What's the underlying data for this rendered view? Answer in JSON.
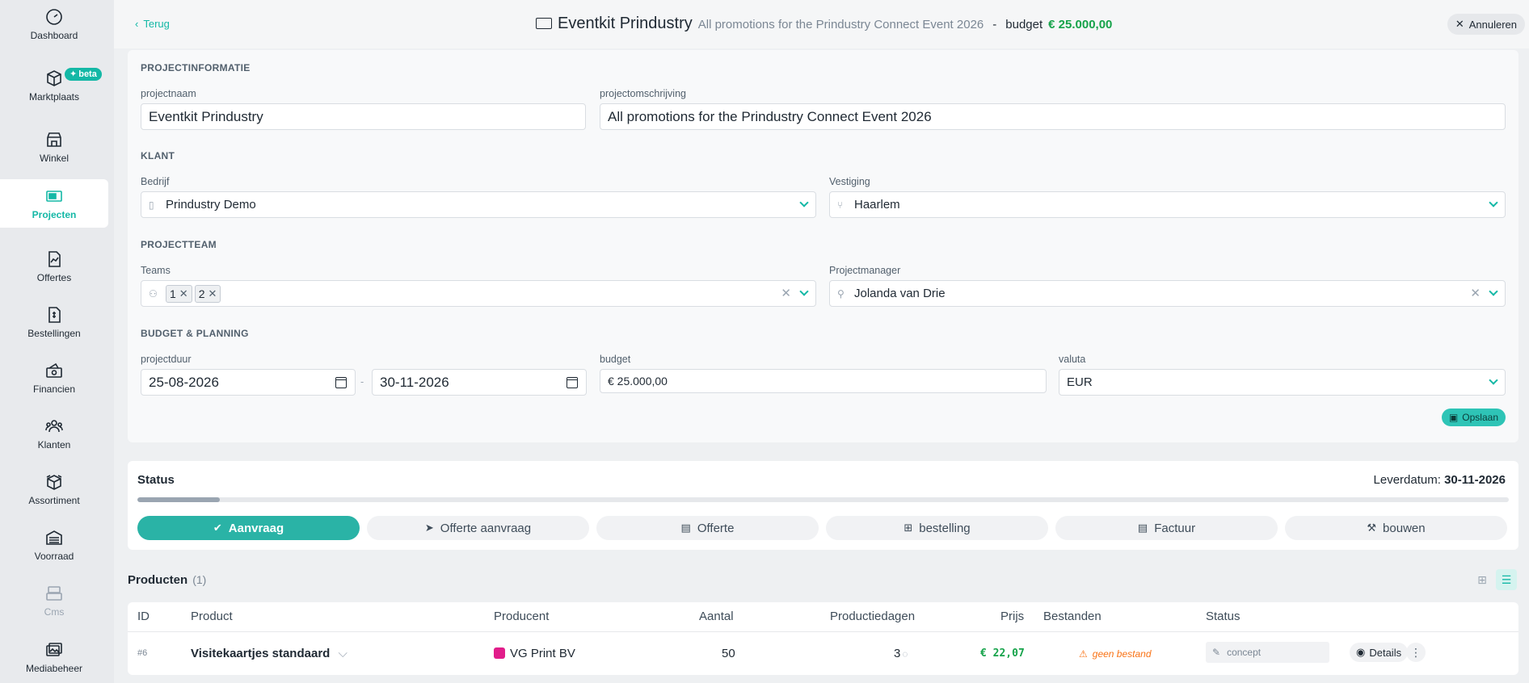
{
  "sidebar": {
    "items": [
      {
        "label": "Dashboard",
        "icon": "speedometer-icon"
      },
      {
        "label": "Marktplaats",
        "icon": "package-icon",
        "badge": "beta"
      },
      {
        "label": "Winkel",
        "icon": "store-icon"
      },
      {
        "label": "Projecten",
        "icon": "project-icon",
        "active": true
      },
      {
        "label": "Offertes",
        "icon": "chart-document-icon"
      },
      {
        "label": "Bestellingen",
        "icon": "invoice-icon"
      },
      {
        "label": "Financien",
        "icon": "money-icon"
      },
      {
        "label": "Klanten",
        "icon": "users-icon"
      },
      {
        "label": "Assortiment",
        "icon": "box-icon"
      },
      {
        "label": "Voorraad",
        "icon": "warehouse-icon"
      },
      {
        "label": "Cms",
        "icon": "cards-icon",
        "disabled": true
      },
      {
        "label": "Mediabeheer",
        "icon": "images-icon"
      }
    ]
  },
  "header": {
    "back_label": "Terug",
    "title": "Eventkit Prindustry",
    "subtitle": "All promotions for the Prindustry Connect Event 2026",
    "separator": "-",
    "budget_label": "budget",
    "budget_value": "€ 25.000,00",
    "cancel_label": "Annuleren"
  },
  "form": {
    "section_info": "PROJECTINFORMATIE",
    "projectname_label": "projectnaam",
    "projectname_value": "Eventkit Prindustry",
    "description_label": "projectomschrijving",
    "description_value": "All promotions for the Prindustry Connect Event 2026",
    "section_client": "KLANT",
    "company_label": "Bedrijf",
    "company_value": "Prindustry Demo",
    "branch_label": "Vestiging",
    "branch_value": "Haarlem",
    "section_team": "PROJECTTEAM",
    "teams_label": "Teams",
    "teams_chips": [
      "1",
      "2"
    ],
    "manager_label": "Projectmanager",
    "manager_value": "Jolanda van Drie",
    "section_budget": "BUDGET & PLANNING",
    "duration_label": "projectduur",
    "start_date": "25-08-2026",
    "date_separator": "-",
    "end_date": "30-11-2026",
    "budget_label": "budget",
    "budget_value": "€ 25.000,00",
    "currency_label": "valuta",
    "currency_value": "EUR",
    "save_label": "Opslaan"
  },
  "status": {
    "title": "Status",
    "delivery_label": "Leverdatum:",
    "delivery_value": "30-11-2026",
    "progress": 0.06,
    "steps": [
      {
        "label": "Aanvraag",
        "icon": "check-circle-icon",
        "active": true
      },
      {
        "label": "Offerte aanvraag",
        "icon": "send-icon"
      },
      {
        "label": "Offerte",
        "icon": "document-icon"
      },
      {
        "label": "bestelling",
        "icon": "cart-icon"
      },
      {
        "label": "Factuur",
        "icon": "invoice-icon"
      },
      {
        "label": "bouwen",
        "icon": "build-icon"
      }
    ]
  },
  "products": {
    "title": "Producten",
    "count": "(1)",
    "columns": [
      "ID",
      "Product",
      "Producent",
      "Aantal",
      "Productiedagen",
      "Prijs",
      "Bestanden",
      "Status"
    ],
    "rows": [
      {
        "id": "#6",
        "product": "Visitekaartjes standaard",
        "producer": "VG Print BV",
        "quantity": "50",
        "production_days": "3",
        "price": "€ 22,07",
        "files": "geen bestand",
        "status": "concept",
        "details_label": "Details"
      }
    ]
  },
  "colors": {
    "accent": "#14b8a6",
    "budget_green": "#16a34a",
    "warning": "#f97316"
  }
}
